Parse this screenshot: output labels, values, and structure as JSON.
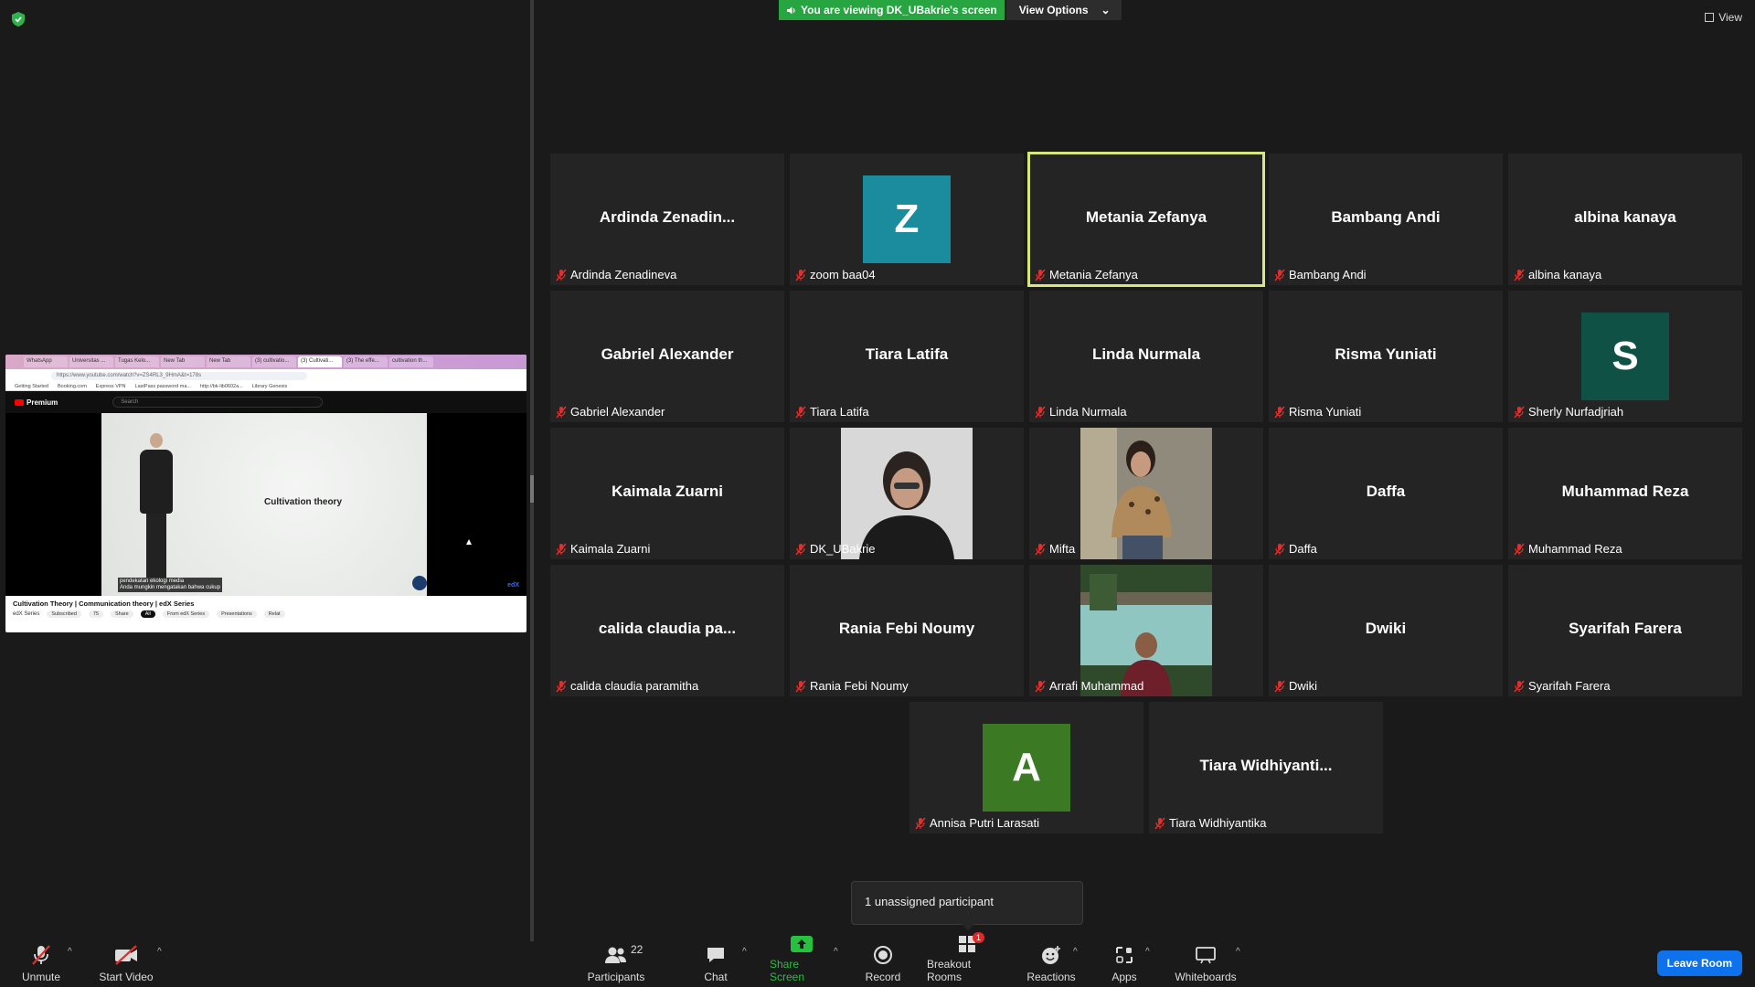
{
  "banner": {
    "viewing_text": "You are viewing DK_UBakrie's screen",
    "view_options_label": "View Options",
    "view_label": "View"
  },
  "shared_screen": {
    "browser_tabs": [
      "WhatsApp",
      "Universitas ...",
      "Tugas Kelo...",
      "New Tab",
      "New Tab",
      "(3) cultivatio...",
      "(3) Cultivati...",
      "(3) The effe...",
      "cultivation th..."
    ],
    "url": "https://www.youtube.com/watch?v=ZS4RL3_9HmA&t=178s",
    "bookmarks": [
      "Getting Started",
      "Booking.com",
      "Express VPN",
      "LastPass password ma...",
      "http://bk-lib0602a...",
      "Library Genesis"
    ],
    "yt_brand": "Premium",
    "search_placeholder": "Search",
    "video_title_overlay": "Cultivation theory",
    "captions": [
      "pendekatan ekologi media",
      "Anda mungkin mengatakan bahwa cukup"
    ],
    "watermark": "edX",
    "video_title": "Cultivation Theory | Communication theory | edX Series",
    "channel": "edX Series",
    "subscribed": "Subscribed",
    "likes": "75",
    "share": "Share",
    "chips": [
      "All",
      "From edX Series",
      "Presentations",
      "Relat"
    ]
  },
  "participants": [
    {
      "display": "Ardinda  Zenadin...",
      "name": "Ardinda Zenadineva"
    },
    {
      "display": "",
      "name": "zoom baa04",
      "avatar_letter": "Z",
      "avatar_color": "#1a8c9e"
    },
    {
      "display": "Metania Zefanya",
      "name": "Metania Zefanya",
      "active": true
    },
    {
      "display": "Bambang Andi",
      "name": "Bambang Andi"
    },
    {
      "display": "albina kanaya",
      "name": "albina kanaya"
    },
    {
      "display": "Gabriel Alexander",
      "name": "Gabriel Alexander"
    },
    {
      "display": "Tiara Latifa",
      "name": "Tiara Latifa"
    },
    {
      "display": "Linda Nurmala",
      "name": "Linda Nurmala"
    },
    {
      "display": "Risma Yuniati",
      "name": "Risma Yuniati"
    },
    {
      "display": "",
      "name": "Sherly Nurfadjriah",
      "avatar_letter": "S",
      "avatar_color": "#0f5144"
    },
    {
      "display": "Kaimala Zuarni",
      "name": "Kaimala Zuarni"
    },
    {
      "display": "",
      "name": "DK_UBakrie",
      "photo": "photo-woman-black"
    },
    {
      "display": "",
      "name": "Mifta",
      "photo": "photo-woman-leopard"
    },
    {
      "display": "Daffa",
      "name": "Daffa"
    },
    {
      "display": "Muhammad Reza",
      "name": "Muhammad Reza"
    },
    {
      "display": "calida claudia pa...",
      "name": "calida claudia paramitha"
    },
    {
      "display": "Rania Febi Noumy",
      "name": "Rania Febi Noumy"
    },
    {
      "display": "",
      "name": "Arrafi Muhammad",
      "photo": "photo-man-lake"
    },
    {
      "display": "Dwiki",
      "name": "Dwiki"
    },
    {
      "display": "Syarifah Farera",
      "name": "Syarifah Farera"
    },
    {
      "display": "",
      "name": "Annisa Putri Larasati",
      "avatar_letter": "A",
      "avatar_color": "#3b7a22"
    },
    {
      "display": "Tiara  Widhiyanti...",
      "name": "Tiara Widhiyantika"
    }
  ],
  "toast": {
    "text": "1 unassigned participant"
  },
  "toolbar": {
    "unmute": "Unmute",
    "start_video": "Start Video",
    "participants": "Participants",
    "participants_count": "22",
    "chat": "Chat",
    "share_screen": "Share Screen",
    "record": "Record",
    "breakout_rooms": "Breakout Rooms",
    "breakout_badge": "1",
    "reactions": "Reactions",
    "apps": "Apps",
    "whiteboards": "Whiteboards",
    "leave": "Leave Room"
  },
  "colors": {
    "active_speaker": "#d8e67e",
    "share_green": "#26a541",
    "leave_blue": "#0e72ed",
    "mute_red": "#e0302d"
  }
}
